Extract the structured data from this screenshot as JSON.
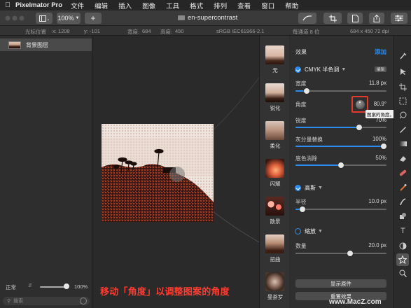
{
  "menubar": {
    "app_name": "Pixelmator Pro",
    "items": [
      "文件",
      "编辑",
      "插入",
      "图像",
      "工具",
      "格式",
      "排列",
      "查看",
      "窗口",
      "帮助"
    ]
  },
  "toolbar": {
    "zoom": "100%",
    "add_label": "+",
    "doc_title": "en-supercontrast"
  },
  "infobar": {
    "cursor_label": "光标位置",
    "cursor_x": "x:  1208",
    "cursor_y": "y:  -101",
    "width_label": "宽度:",
    "width_value": "684",
    "height_label": "高度:",
    "height_value": "450",
    "color_profile": "sRGB IEC61966-2.1",
    "bit_depth": "每通道 8 位",
    "dimensions": "684 x 450 72 dpi"
  },
  "layers": {
    "items": [
      {
        "label": "背景图层"
      }
    ],
    "blend_mode": "正常",
    "opacity": "100%",
    "opacity_fraction": 1.0,
    "search_placeholder": "搜索"
  },
  "canvas": {
    "caption": "移动「角度」以调整图案的角度"
  },
  "presets": [
    {
      "label": "无"
    },
    {
      "label": "锐化"
    },
    {
      "label": "柔化"
    },
    {
      "label": "闪耀"
    },
    {
      "label": "散景"
    },
    {
      "label": "扭曲"
    },
    {
      "label": "曼荼罗"
    }
  ],
  "effects": {
    "header": "效果",
    "add_label": "添加",
    "cmyk": {
      "title": "CMYK 半色调",
      "edit_label": "编辑",
      "width_label": "宽度",
      "width_value": "11.8 px",
      "width_fraction": 0.12,
      "angle_label": "角度",
      "angle_value": "80.9°",
      "angle_tooltip": "图案的角度。",
      "sharpness_label": "锐度",
      "sharpness_value": "70%",
      "sharpness_fraction": 0.7,
      "gcr_label": "灰分量替换",
      "gcr_value": "100%",
      "gcr_fraction": 1.0,
      "ucr_label": "底色消除",
      "ucr_value": "50%",
      "ucr_fraction": 0.5
    },
    "gaussian": {
      "title": "高斯",
      "radius_label": "半径",
      "radius_value": "10.0 px",
      "radius_fraction": 0.08
    },
    "zoom": {
      "title": "缩放",
      "amount_label": "数量",
      "amount_value": "20.0 px",
      "amount_fraction": 0.6
    },
    "show_original_label": "显示原件",
    "reset_label": "重置效果"
  },
  "watermark": "www.MacZ.com",
  "colors": {
    "accent": "#2d8cf0",
    "highlight_box": "#e13b2c",
    "caption": "#ff3b30"
  },
  "tools": [
    "paint-brush-icon",
    "arrow-icon",
    "crop-icon",
    "selection-icon",
    "eyedropper-icon",
    "pen-icon",
    "gradient-icon",
    "eraser-icon",
    "repair-icon",
    "clone-icon",
    "shape-icon",
    "text-icon",
    "color-adjust-icon",
    "effects-icon",
    "zoom-icon"
  ]
}
